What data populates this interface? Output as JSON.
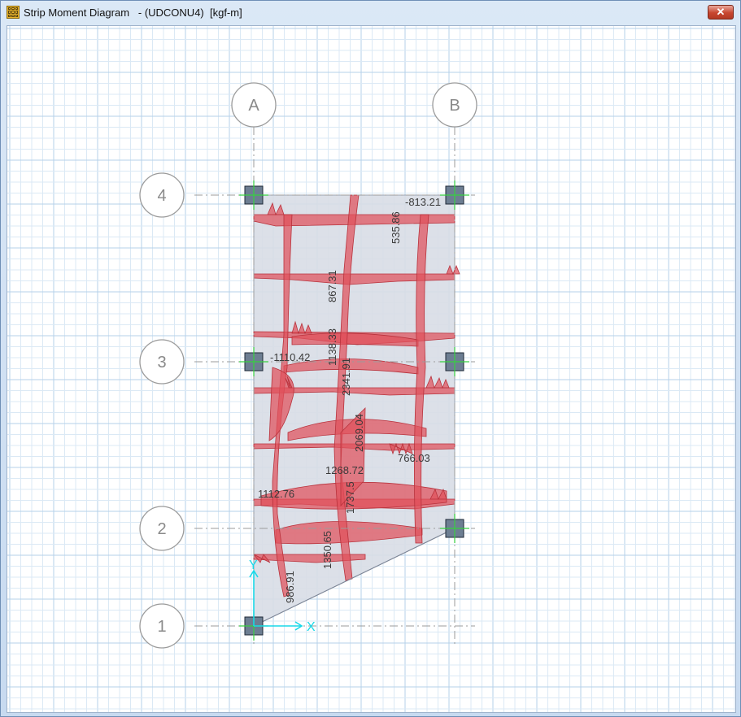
{
  "window": {
    "title": "Strip Moment Diagram   - (UDCONU4)  [kgf-m]",
    "close_label": "✕"
  },
  "colors": {
    "grid_minor": "#dbe9f5",
    "grid_major": "#b5d1ea",
    "slab": "#d8dde6",
    "moment_fill": "#e0505c",
    "column": "#6d7e92",
    "axis": "#19d8e8"
  },
  "gridlines": {
    "columns": [
      "A",
      "B"
    ],
    "rows": [
      "4",
      "3",
      "2",
      "1"
    ]
  },
  "moment_labels": [
    "-813.21",
    "535.86",
    "867.31",
    "-1110.42",
    "1138.33",
    "2341.91",
    "2069.04",
    "766.03",
    "1268.72",
    "1112.76",
    "1737.5",
    "1350.65",
    "986.91"
  ],
  "axes": {
    "x_label": "X",
    "y_label": "Y"
  }
}
